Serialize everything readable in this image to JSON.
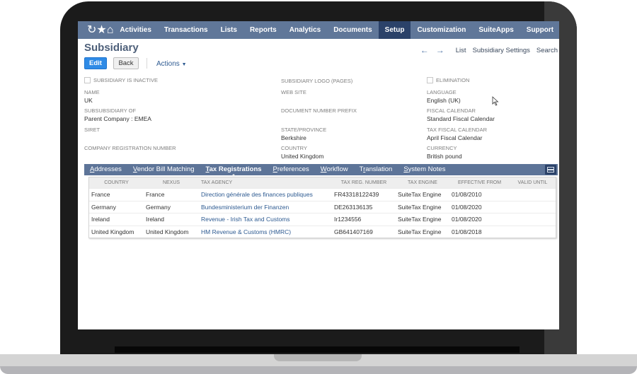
{
  "nav": {
    "icons": [
      "recent-icon",
      "star-icon",
      "home-icon"
    ],
    "items": [
      {
        "label": "Activities",
        "active": false
      },
      {
        "label": "Transactions",
        "active": false
      },
      {
        "label": "Lists",
        "active": false
      },
      {
        "label": "Reports",
        "active": false
      },
      {
        "label": "Analytics",
        "active": false
      },
      {
        "label": "Documents",
        "active": false
      },
      {
        "label": "Setup",
        "active": true
      },
      {
        "label": "Customization",
        "active": false
      },
      {
        "label": "SuiteApps",
        "active": false
      },
      {
        "label": "Support",
        "active": false
      }
    ]
  },
  "page": {
    "title": "Subsidiary",
    "edit_label": "Edit",
    "back_label": "Back",
    "actions_label": "Actions",
    "right_links": {
      "list": "List",
      "settings": "Subsidiary Settings",
      "search": "Search"
    }
  },
  "fields": {
    "inactive": {
      "label": "Subsidiary is inactive",
      "checked": false
    },
    "name": {
      "label": "Name",
      "value": "UK"
    },
    "subsidiary_of": {
      "label": "Subsubsidiary of",
      "value": "Parent Company : EMEA"
    },
    "siret": {
      "label": "SIRET",
      "value": ""
    },
    "company_reg": {
      "label": "Company Registration Number",
      "value": ""
    },
    "logo": {
      "label": "Subsidiary Logo (Pages)",
      "value": ""
    },
    "website": {
      "label": "Web Site",
      "value": ""
    },
    "doc_prefix": {
      "label": "Document Number Prefix",
      "value": ""
    },
    "state": {
      "label": "State/Province",
      "value": "Berkshire"
    },
    "country": {
      "label": "Country",
      "value": "United Kingdom"
    },
    "elimination": {
      "label": "Elimination",
      "checked": false
    },
    "language": {
      "label": "Language",
      "value": "English (UK)"
    },
    "fiscal_calendar": {
      "label": "Fiscal Calendar",
      "value": "Standard Fiscal Calendar"
    },
    "tax_fiscal_calendar": {
      "label": "Tax Fiscal Calendar",
      "value": "April Fiscal Calendar"
    },
    "currency": {
      "label": "Currency",
      "value": "British pound"
    }
  },
  "subtabs": [
    {
      "first": "A",
      "rest": "ddresses",
      "active": false
    },
    {
      "first": "V",
      "rest": "endor Bill Matching",
      "active": false
    },
    {
      "first": "T",
      "rest": "ax Registrations",
      "active": true
    },
    {
      "first": "P",
      "rest": "references",
      "active": false
    },
    {
      "first": "W",
      "rest": "orkflow",
      "active": false
    },
    {
      "pre": "T",
      "first": "r",
      "rest": "anslation",
      "active": false
    },
    {
      "first": "S",
      "rest": "ystem Notes",
      "active": false
    }
  ],
  "table": {
    "headers": [
      "Country",
      "Nexus",
      "Tax Agency",
      "Tax Reg. Number",
      "Tax Engine",
      "Effective From",
      "Valid Until"
    ],
    "rows": [
      [
        "France",
        "France",
        "Direction générale des finances publiques",
        "FR43318122439",
        "SuiteTax Engine",
        "01/08/2010",
        ""
      ],
      [
        "Germany",
        "Germany",
        "Bundesministerium der Finanzen",
        "DE263136135",
        "SuiteTax Engine",
        "01/08/2020",
        ""
      ],
      [
        "Ireland",
        "Ireland",
        "Revenue - Irish Tax and Customs",
        "Ir1234556",
        "SuiteTax Engine",
        "01/08/2020",
        ""
      ],
      [
        "United Kingdom",
        "United Kingdom",
        "HM Revenue & Customs (HMRC)",
        "GB641407169",
        "SuiteTax Engine",
        "01/08/2018",
        ""
      ]
    ]
  }
}
